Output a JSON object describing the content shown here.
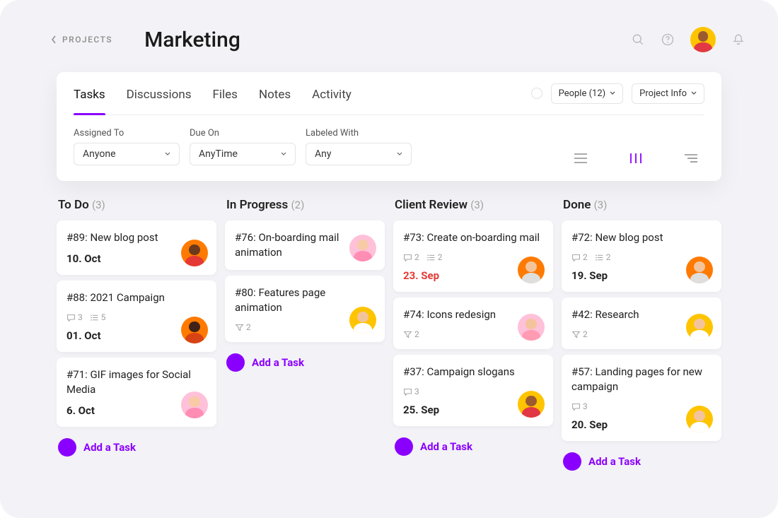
{
  "breadcrumb": {
    "back_label": "PROJECTS"
  },
  "page_title": "Marketing",
  "header_icons": {
    "search": "search-icon",
    "help": "help-icon",
    "bell": "bell-icon"
  },
  "tabs": [
    {
      "label": "Tasks",
      "active": true
    },
    {
      "label": "Discussions"
    },
    {
      "label": "Files"
    },
    {
      "label": "Notes"
    },
    {
      "label": "Activity"
    }
  ],
  "panel_right": {
    "people_label": "People (12)",
    "project_info_label": "Project Info"
  },
  "filters": {
    "assigned": {
      "label": "Assigned To",
      "value": "Anyone"
    },
    "due": {
      "label": "Due On",
      "value": "AnyTime"
    },
    "labeled": {
      "label": "Labeled With",
      "value": "Any"
    }
  },
  "add_task_label": "Add a Task",
  "columns": [
    {
      "title": "To Do",
      "count": "(3)",
      "cards": [
        {
          "title": "#89: New blog post",
          "date": "10. Oct",
          "avatar": "av-orange-dark"
        },
        {
          "title": "#88: 2021 Campaign",
          "comments": "3",
          "subtasks": "5",
          "date": "01. Oct",
          "avatar": "av-orange-redbody"
        },
        {
          "title": "#71: GIF images for Social Media",
          "date": "6. Oct",
          "avatar": "av-pink-light"
        }
      ]
    },
    {
      "title": "In Progress",
      "count": "(2)",
      "cards": [
        {
          "title": "#76: On-boarding mail animation",
          "avatar": "av-pink-light"
        },
        {
          "title": "#80: Features page animation",
          "subtasks_alt": "2",
          "avatar": "av-yellow-beard"
        }
      ]
    },
    {
      "title": "Client Review",
      "count": "(3)",
      "cards": [
        {
          "title": "#73: Create on-boarding mail",
          "comments": "2",
          "subtasks": "2",
          "date": "23. Sep",
          "overdue": true,
          "avatar": "av-orange-white"
        },
        {
          "title": "#74: Icons redesign",
          "subtasks_alt": "2",
          "avatar": "av-pink-purse"
        },
        {
          "title": "#37: Campaign slogans",
          "comments": "3",
          "date": "25. Sep",
          "avatar": "av-gold"
        }
      ]
    },
    {
      "title": "Done",
      "count": "(3)",
      "cards": [
        {
          "title": "#72: New blog post",
          "comments": "2",
          "subtasks": "2",
          "date": "19. Sep",
          "avatar": "av-orange-white"
        },
        {
          "title": "#42: Research",
          "subtasks_alt": "2",
          "avatar": "av-yellow-beard"
        },
        {
          "title": "#57: Landing pages for new campaign",
          "comments": "3",
          "date": "20. Sep",
          "avatar": "av-yellow-beard"
        }
      ]
    }
  ]
}
